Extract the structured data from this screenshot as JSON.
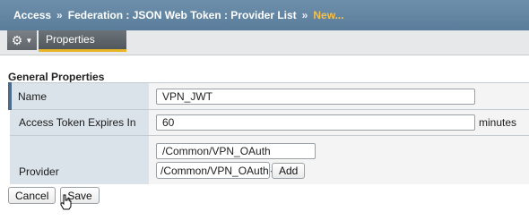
{
  "breadcrumb": {
    "root": "Access",
    "sep": "»",
    "path": "Federation : JSON Web Token : Provider List",
    "current": "New..."
  },
  "menu": {
    "gear_icon": "gear-icon",
    "tab_label": "Properties"
  },
  "section": {
    "title": "General Properties"
  },
  "fields": {
    "name_label": "Name",
    "name_value": "VPN_JWT",
    "expires_label": "Access Token Expires In",
    "expires_value": "60",
    "expires_unit": "minutes",
    "provider_label": "Provider",
    "provider_value": "/Common/VPN_OAuth",
    "provider_select": "/Common/VPN_OAuth",
    "add_label": "Add"
  },
  "actions": {
    "cancel_label": "Cancel",
    "save_label": "Save"
  },
  "colors": {
    "header_bg": "#5a7d9b",
    "breadcrumb_current": "#f2c14e",
    "tab_underline": "#e8b526",
    "label_bg": "#dbe3ea",
    "focus_border": "#3a78d6"
  }
}
